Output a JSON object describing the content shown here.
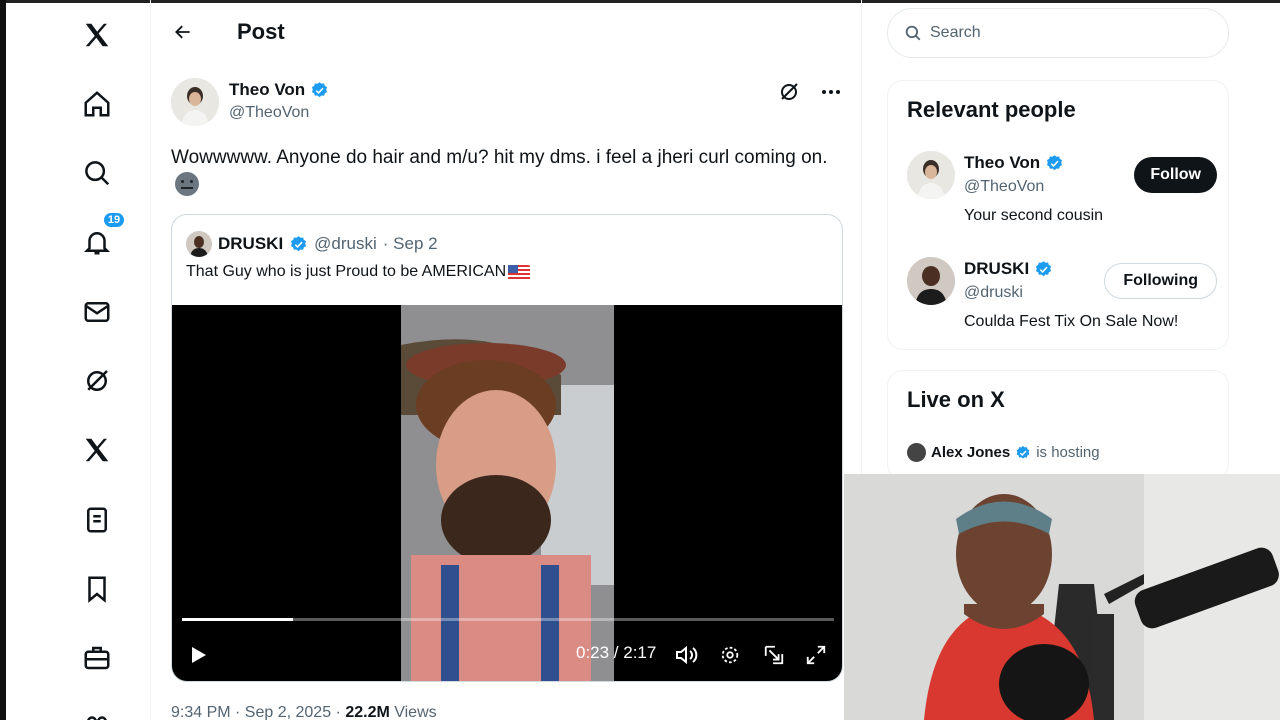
{
  "nav": {
    "notifications_badge": "19"
  },
  "header": {
    "title": "Post"
  },
  "post": {
    "author_name": "Theo Von",
    "author_handle": "@TheoVon",
    "text": "Wowwwww.  Anyone do hair and m/u? hit my dms. i feel a jheri curl coming on.",
    "quote": {
      "name": "DRUSKI",
      "handle": "@druski",
      "date": "· Sep 2",
      "text": "That Guy who is just Proud to be AMERICAN"
    },
    "video": {
      "time": "0:23 / 2:17",
      "progress": 0.17
    },
    "meta": {
      "timestamp": "9:34 PM · Sep 2, 2025 · ",
      "views_count": "22.2M",
      "views_label": " Views"
    }
  },
  "search": {
    "placeholder": "Search"
  },
  "relevant_people": {
    "title": "Relevant people",
    "people": [
      {
        "name": "Theo Von",
        "handle": "@TheoVon",
        "bio": "Your second cousin",
        "button": "Follow"
      },
      {
        "name": "DRUSKI",
        "handle": "@druski",
        "bio": "Coulda Fest Tix On Sale Now!",
        "button": "Following"
      }
    ]
  },
  "live": {
    "title": "Live on X",
    "host_name": "Alex Jones",
    "host_status": "is hosting"
  },
  "colors": {
    "accent": "#1d9bf0",
    "text": "#0f1419",
    "secondary": "#536471"
  }
}
